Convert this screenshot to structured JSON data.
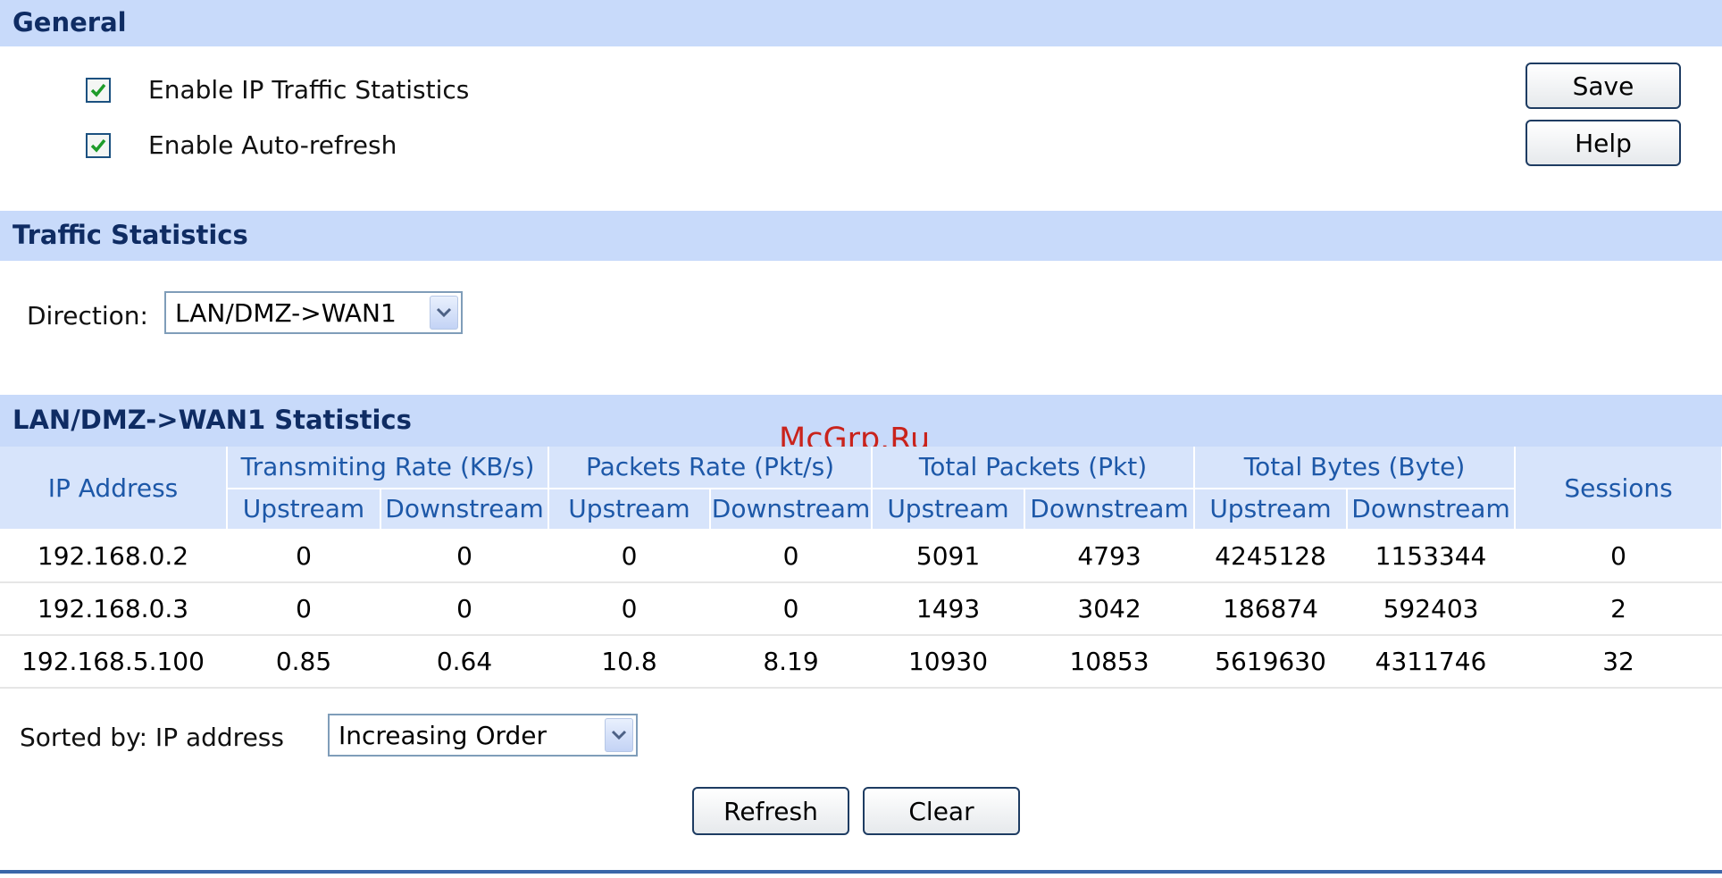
{
  "general": {
    "title": "General",
    "enable_ip_traffic": {
      "label": "Enable IP Traffic Statistics",
      "checked": true
    },
    "enable_auto_refresh": {
      "label": "Enable Auto-refresh",
      "checked": true
    },
    "save_label": "Save",
    "help_label": "Help"
  },
  "traffic": {
    "title": "Traffic Statistics",
    "direction_label": "Direction:",
    "direction_value": "LAN/DMZ->WAN1"
  },
  "stats": {
    "title": "LAN/DMZ->WAN1 Statistics",
    "headers": {
      "ip": "IP Address",
      "transmit_rate": "Transmiting Rate (KB/s)",
      "packets_rate": "Packets Rate (Pkt/s)",
      "total_packets": "Total Packets (Pkt)",
      "total_bytes": "Total Bytes (Byte)",
      "sessions": "Sessions",
      "upstream": "Upstream",
      "downstream": "Downstream"
    },
    "rows": [
      [
        "192.168.0.2",
        "0",
        "0",
        "0",
        "0",
        "5091",
        "4793",
        "4245128",
        "1153344",
        "0"
      ],
      [
        "192.168.0.3",
        "0",
        "0",
        "0",
        "0",
        "1493",
        "3042",
        "186874",
        "592403",
        "2"
      ],
      [
        "192.168.5.100",
        "0.85",
        "0.64",
        "10.8",
        "8.19",
        "10930",
        "10853",
        "5619630",
        "4311746",
        "32"
      ]
    ]
  },
  "sort": {
    "label": "Sorted by: IP address",
    "value": "Increasing Order"
  },
  "actions": {
    "refresh_label": "Refresh",
    "clear_label": "Clear"
  },
  "watermark": "McGrp.Ru",
  "colors": {
    "section_bar": "#c8dafa",
    "section_title": "#0f2c63",
    "header_text": "#1d58a8",
    "checkmark": "#1e9c2a"
  }
}
